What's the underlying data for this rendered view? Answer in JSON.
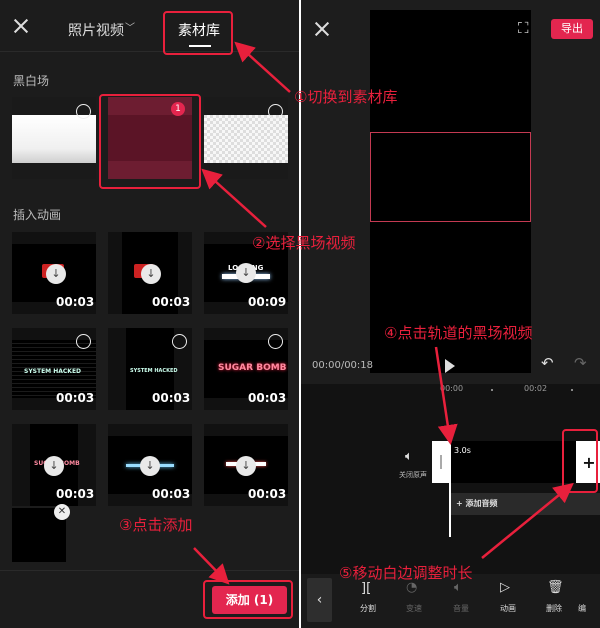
{
  "left_panel": {
    "tab_photos_video": "照片视频",
    "tab_material": "素材库",
    "section_black_white": "黑白场",
    "section_insert_anim": "插入动画",
    "selected_badge": "1",
    "anim_items": [
      {
        "title": "",
        "duration": "00:03"
      },
      {
        "title": "",
        "duration": "00:03"
      },
      {
        "title": "LOADING",
        "duration": "00:09"
      },
      {
        "title": "SYSTEM HACKED",
        "duration": "00:03"
      },
      {
        "title": "SYSTEM HACKED",
        "duration": "00:03"
      },
      {
        "title": "SUGAR BOMB",
        "duration": "00:03"
      },
      {
        "title": "SUGAR BOMB",
        "duration": "00:03"
      },
      {
        "title": "",
        "duration": "00:03"
      },
      {
        "title": "",
        "duration": "00:03"
      }
    ],
    "add_button": "添加 (1)"
  },
  "right_panel": {
    "export_button": "导出",
    "time_display": "00:00/00:18",
    "ruler": [
      "00:00",
      "00:02"
    ],
    "clip_duration": "3.0s",
    "mute_label": "关闭原声",
    "add_audio": "+ 添加音频",
    "toolbar": [
      "分割",
      "变速",
      "音量",
      "动画",
      "删除",
      "编"
    ]
  },
  "annotations": {
    "step1": "①切换到素材库",
    "step2": "②选择黑场视频",
    "step3": "③点击添加",
    "step4": "④点击轨道的黑场视频",
    "step5": "⑤移动白边调整时长"
  },
  "colors": {
    "accent": "#e3264f",
    "annotation": "#e8203c"
  }
}
